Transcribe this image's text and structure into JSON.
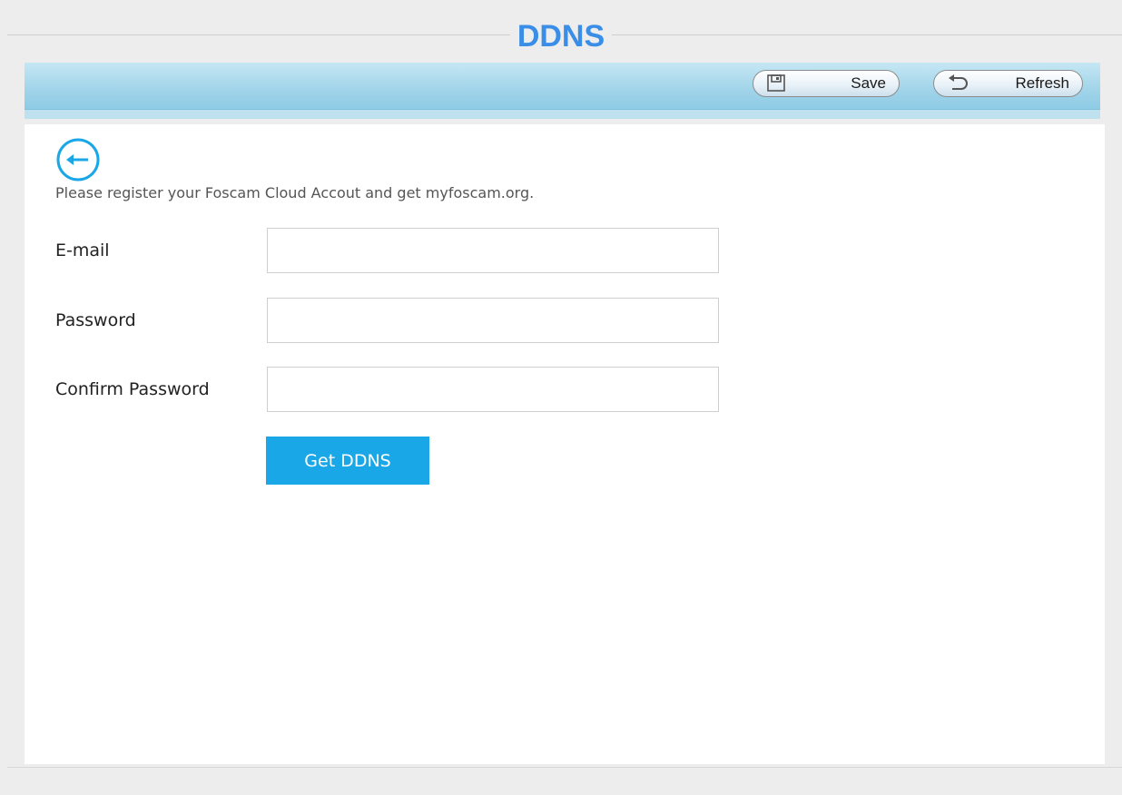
{
  "header": {
    "title": "DDNS"
  },
  "toolbar": {
    "save_label": "Save",
    "refresh_label": "Refresh",
    "icons": {
      "save": "floppy-disk-icon",
      "refresh": "refresh-arrow-icon"
    }
  },
  "form": {
    "back_icon": "arrow-left-circle-icon",
    "intro": "Please register your Foscam Cloud Accout and get myfoscam.org.",
    "fields": {
      "email": {
        "label": "E-mail",
        "value": "",
        "placeholder": ""
      },
      "password": {
        "label": "Password",
        "value": "",
        "placeholder": ""
      },
      "confirm_password": {
        "label": "Confirm Password",
        "value": "",
        "placeholder": ""
      }
    },
    "submit_label": "Get DDNS"
  },
  "colors": {
    "title": "#3b8ee8",
    "accent_button": "#1aa7e8",
    "toolbar": "#a3d5ea",
    "background": "#ededed"
  }
}
